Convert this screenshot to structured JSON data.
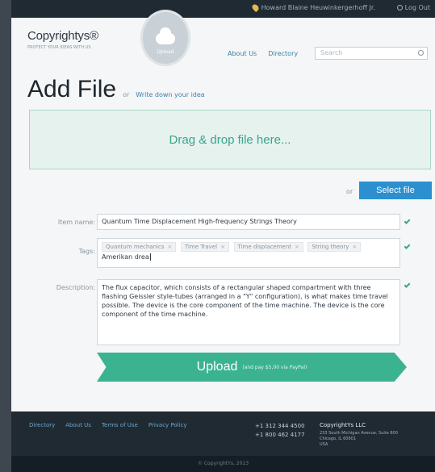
{
  "topbar": {
    "user_name": "Howard Blaine Heuwinkergerhoff Jr.",
    "logout_label": "Log Out"
  },
  "header": {
    "logo": "Copyrightys®",
    "logo_tagline": "PROTECT YOUR IDEAS WITH US",
    "badge_label": "Upload",
    "nav": [
      "About Us",
      "Directory"
    ],
    "search_placeholder": "Search"
  },
  "main": {
    "title": "Add File",
    "title_sep": "or",
    "title_link": "Write down your idea",
    "dropzone_text": "Drag & drop file here...",
    "or_label": "or",
    "select_file": "Select file"
  },
  "form": {
    "item_name_label": "Item name:",
    "item_name_value": "Quantum Time Displacement High-frequency Strings Theory",
    "tags_label": "Tags:",
    "tags": [
      "Quantum mechanics",
      "Time Travel",
      "Time displacement",
      "String theory"
    ],
    "tags_input": "Amerikan drea",
    "description_label": "Description:",
    "description_value": "The flux capacitor, which consists of a rectangular shaped compartment with three flashing Geissler style-tubes (arranged in a \"Y\" configuration), is what makes time travel possible. The device is the core component of the time machine. The device is the core component of the time machine.",
    "upload_label": "Upload",
    "upload_price": "(and pay $5,00 via PayPal)"
  },
  "footer": {
    "links": [
      "Directory",
      "About Us",
      "Terms of Use",
      "Privacy Policy"
    ],
    "phone1": "+1 312 344 4500",
    "phone2": "+1 800 462 4177",
    "company": "CopyrightYs LLC",
    "address1": "233 South Michigan Avenue, Suite 800",
    "address2": "Chicago, IL 60601",
    "address3": "USA",
    "copyright": "© CopyrightYs, 2013"
  },
  "colors": {
    "accent_green": "#3bb391",
    "accent_blue": "#2b8fd0",
    "dark": "#1f2a33"
  }
}
